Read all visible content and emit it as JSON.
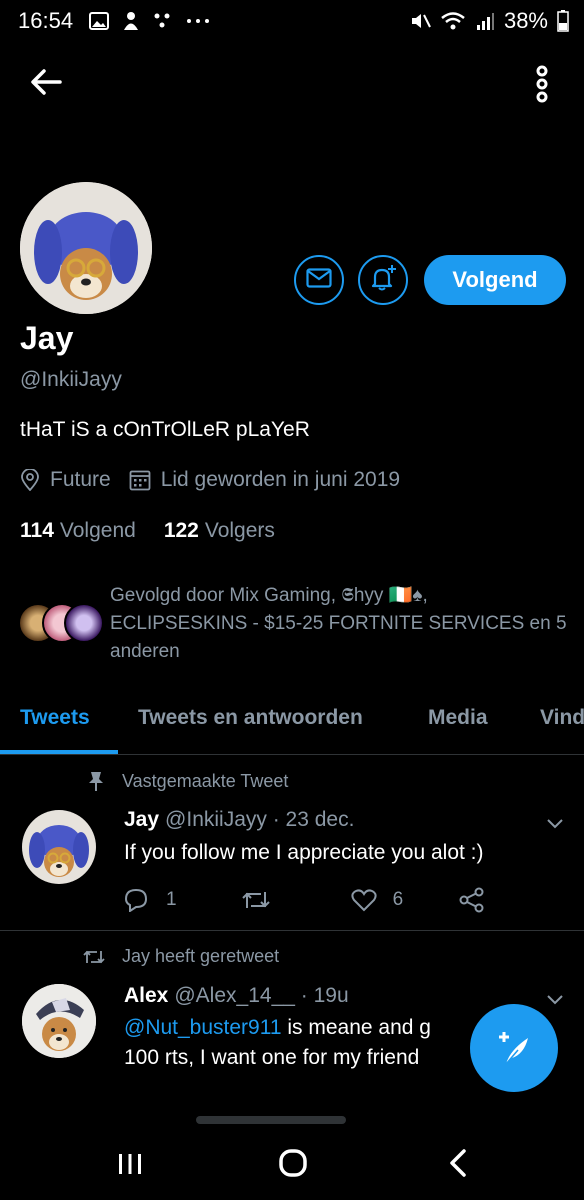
{
  "status_bar": {
    "time": "16:54",
    "battery": "38%"
  },
  "profile": {
    "name": "Jay",
    "handle": "@InkiiJayy",
    "bio": "tHaT iS a cOnTrOlLeR pLaYeR",
    "location": "Future",
    "joined": "Lid geworden in juni 2019",
    "following_count": "114",
    "following_label": "Volgend",
    "followers_count": "122",
    "followers_label": "Volgers",
    "follow_button": "Volgend",
    "followed_by": "Gevolgd door Mix Gaming, 𝕾hyy 🇮🇪♠, ECLIPSESKINS - $15-25 FORTNITE SERVICES en 5 anderen"
  },
  "tabs": [
    "Tweets",
    "Tweets en antwoorden",
    "Media",
    "Vind"
  ],
  "tweets": [
    {
      "context": "Vastgemaakte Tweet",
      "name": "Jay",
      "handle": "@InkiiJayy",
      "time": "· 23 dec.",
      "text": "If you follow me I appreciate you alot :)",
      "replies": "1",
      "likes": "6"
    },
    {
      "context": "Jay heeft geretweet",
      "name": "Alex",
      "handle": "@Alex_14__",
      "time": "· 19u",
      "mention": "@Nut_buster911",
      "text_line1": " is meane and g",
      "text_line2": "100 rts, I want one for my friend"
    }
  ],
  "colors": {
    "accent": "#1d9bf0",
    "muted": "#8b98a5",
    "background": "#000000"
  },
  "icons": [
    "back-arrow-icon",
    "more-vertical-icon",
    "mail-icon",
    "bell-plus-icon",
    "location-icon",
    "calendar-icon",
    "pin-icon",
    "retweet-icon",
    "reply-icon",
    "like-icon",
    "share-icon",
    "chevron-down-icon",
    "compose-icon"
  ]
}
